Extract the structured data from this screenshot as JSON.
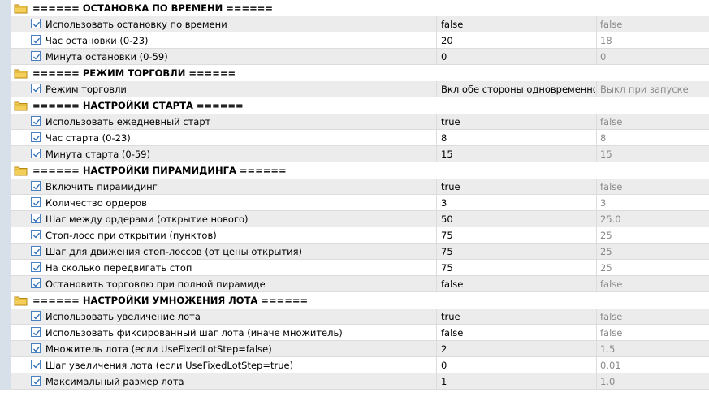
{
  "groups": [
    {
      "title": "====== ОСТАНОВКА ПО ВРЕМЕНИ ======",
      "params": [
        {
          "name": "Использовать остановку по времени",
          "value": "false",
          "default": "false"
        },
        {
          "name": "Час остановки (0-23)",
          "value": "20",
          "default": "18"
        },
        {
          "name": "Минута остановки (0-59)",
          "value": "0",
          "default": "0"
        }
      ]
    },
    {
      "title": "====== РЕЖИМ ТОРГОВЛИ ======",
      "params": [
        {
          "name": "Режим торговли",
          "value": "Вкл обе стороны одновременно",
          "default": "Выкл при запуске"
        }
      ]
    },
    {
      "title": "====== НАСТРОЙКИ СТАРТА ======",
      "params": [
        {
          "name": "Использовать ежедневный старт",
          "value": "true",
          "default": "false"
        },
        {
          "name": "Час старта (0-23)",
          "value": "8",
          "default": "8"
        },
        {
          "name": "Минута старта (0-59)",
          "value": "15",
          "default": "15"
        }
      ]
    },
    {
      "title": "====== НАСТРОЙКИ ПИРАМИДИНГА ======",
      "params": [
        {
          "name": "Включить пирамидинг",
          "value": "true",
          "default": "false"
        },
        {
          "name": "Количество ордеров",
          "value": "3",
          "default": "3"
        },
        {
          "name": "Шаг между ордерами (открытие нового)",
          "value": "50",
          "default": "25.0"
        },
        {
          "name": "Стоп-лосс при открытии (пунктов)",
          "value": "75",
          "default": "25"
        },
        {
          "name": "Шаг для движения стоп-лоссов (от цены открытия)",
          "value": "75",
          "default": "25"
        },
        {
          "name": "На сколько передвигать стоп",
          "value": "75",
          "default": "25"
        },
        {
          "name": "Остановить торговлю при полной пирамиде",
          "value": "false",
          "default": "false"
        }
      ]
    },
    {
      "title": "====== НАСТРОЙКИ УМНОЖЕНИЯ ЛОТА ======",
      "params": [
        {
          "name": "Использовать увеличение лота",
          "value": "true",
          "default": "false"
        },
        {
          "name": "Использовать фиксированный шаг лота (иначе множитель)",
          "value": "false",
          "default": "false"
        },
        {
          "name": "Множитель лота (если UseFixedLotStep=false)",
          "value": "2",
          "default": "1.5"
        },
        {
          "name": "Шаг увеличения лота (если UseFixedLotStep=true)",
          "value": "0",
          "default": "0.01"
        },
        {
          "name": "Максимальный размер лота",
          "value": "1",
          "default": "1.0"
        }
      ]
    }
  ],
  "colors": {
    "checkbox_border": "#4a7fc1",
    "checkmark": "#2f6fb8",
    "folder": "#e8b93a",
    "alt_row": "#ececec",
    "default_text": "#8a8a8a"
  },
  "icons": {
    "group": "folder-icon",
    "param": "checkbox-checked-icon"
  }
}
